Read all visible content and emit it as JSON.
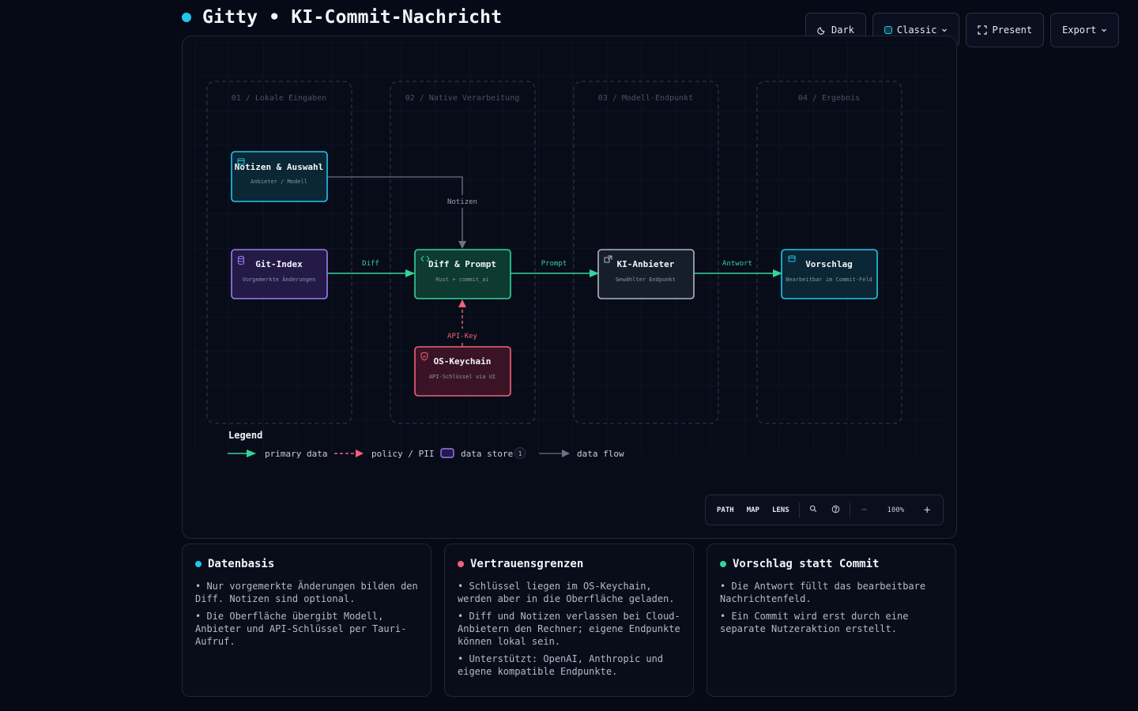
{
  "header": {
    "title": "Gitty • KI-Commit-Nachricht",
    "dot_color": "#22c7e8"
  },
  "toolbar": {
    "theme_label": "Dark",
    "style_label": "Classic",
    "present_label": "Present",
    "export_label": "Export"
  },
  "lanes": [
    {
      "label": "01 / Lokale Eingaben"
    },
    {
      "label": "02 / Native Verarbeitung"
    },
    {
      "label": "03 / Modell-Endpunkt"
    },
    {
      "label": "04 / Ergebnis"
    }
  ],
  "nodes": {
    "notes": {
      "title": "Notizen & Auswahl",
      "sub": "Anbieter / Modell",
      "color": "#22c7e8",
      "icon": "window-icon"
    },
    "git": {
      "title": "Git-Index",
      "sub": "Vorgemerkte Änderungen",
      "color": "#9b7cf0",
      "icon": "database-icon"
    },
    "diff": {
      "title": "Diff & Prompt",
      "sub": "Rust + commit_ai",
      "color": "#34d399",
      "icon": "code-icon"
    },
    "ai": {
      "title": "KI-Anbieter",
      "sub": "Gewählter Endpunkt",
      "color": "#aeb6c4",
      "icon": "external-icon"
    },
    "suggest": {
      "title": "Vorschlag",
      "sub": "Bearbeitbar im Commit-Feld",
      "color": "#22c7e8",
      "icon": "window-icon"
    },
    "keychain": {
      "title": "OS-Keychain",
      "sub": "API-Schlüssel via UI",
      "color": "#f0617a",
      "icon": "shield-icon"
    }
  },
  "edges": {
    "notizen": "Notizen",
    "diff": "Diff",
    "prompt": "Prompt",
    "antwort": "Antwort",
    "apikey": "API-Key"
  },
  "legend": {
    "title": "Legend",
    "primary": "primary data",
    "policy": "policy / PII",
    "store": "data store",
    "store_count": "1",
    "flow": "data flow"
  },
  "controls": {
    "path": "PATH",
    "map": "MAP",
    "lens": "LENS",
    "zoom": "100%",
    "minus": "−",
    "plus": "+"
  },
  "cards": [
    {
      "title": "Datenbasis",
      "color": "#22c7e8",
      "items": [
        "• Nur vorgemerkte Änderungen bilden den Diff. Notizen sind optional.",
        "• Die Oberfläche übergibt Modell, Anbieter und API-Schlüssel per Tauri-Aufruf."
      ]
    },
    {
      "title": "Vertrauensgrenzen",
      "color": "#f0617a",
      "items": [
        "• Schlüssel liegen im OS-Keychain, werden aber in die Oberfläche geladen.",
        "• Diff und Notizen verlassen bei Cloud-Anbietern den Rechner; eigene Endpunkte können lokal sein.",
        "• Unterstützt: OpenAI, Anthropic und eigene kompatible Endpunkte."
      ]
    },
    {
      "title": "Vorschlag statt Commit",
      "color": "#34d399",
      "items": [
        "• Die Antwort füllt das bearbeitbare Nachrichtenfeld.",
        "• Ein Commit wird erst durch eine separate Nutzeraktion erstellt."
      ]
    }
  ]
}
